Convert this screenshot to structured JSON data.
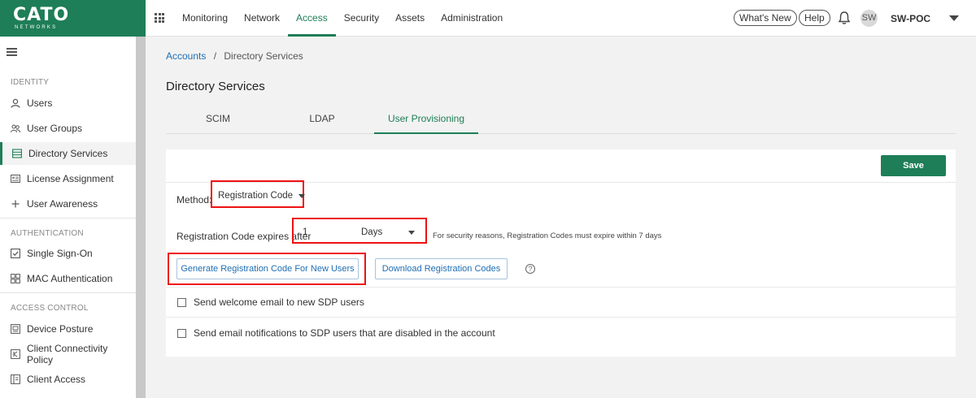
{
  "brand": {
    "name": "CATO",
    "subtitle": "NETWORKS",
    "color": "#1e7e57"
  },
  "topnav": {
    "items": [
      "Monitoring",
      "Network",
      "Access",
      "Security",
      "Assets",
      "Administration"
    ],
    "active": "Access",
    "whats_new": "What's New",
    "help": "Help",
    "avatar_initials": "SW",
    "account_name": "SW-POC"
  },
  "sidebar": {
    "sections": [
      {
        "title": "IDENTITY",
        "items": [
          {
            "label": "Users",
            "icon": "user-icon"
          },
          {
            "label": "User Groups",
            "icon": "user-group-icon"
          },
          {
            "label": "Directory Services",
            "icon": "directory-icon",
            "active": true
          },
          {
            "label": "License Assignment",
            "icon": "license-icon"
          },
          {
            "label": "User Awareness",
            "icon": "plus-icon"
          }
        ]
      },
      {
        "title": "AUTHENTICATION",
        "items": [
          {
            "label": "Single Sign-On",
            "icon": "checkbox-icon"
          },
          {
            "label": "MAC Authentication",
            "icon": "grid-icon"
          }
        ]
      },
      {
        "title": "ACCESS CONTROL",
        "items": [
          {
            "label": "Device Posture",
            "icon": "device-icon"
          },
          {
            "label": "Client Connectivity Policy",
            "icon": "policy-icon"
          },
          {
            "label": "Client Access",
            "icon": "client-access-icon"
          }
        ]
      }
    ]
  },
  "breadcrumb": {
    "parent": "Accounts",
    "separator": "/",
    "current": "Directory Services"
  },
  "page_title": "Directory Services",
  "tabs": [
    {
      "label": "SCIM"
    },
    {
      "label": "LDAP"
    },
    {
      "label": "User Provisioning",
      "active": true
    }
  ],
  "form": {
    "save_label": "Save",
    "method_label": "Method:",
    "method_value": "Registration Code",
    "expires_label": "Registration Code expires after",
    "expires_value": "1",
    "expires_unit": "Days",
    "expires_hint": "For security reasons, Registration Codes must expire within 7 days",
    "generate_button": "Generate Registration Code For New Users",
    "download_button": "Download Registration Codes",
    "help_glyph": "?",
    "checkboxes": [
      {
        "label": "Send welcome email to new SDP users",
        "checked": false
      },
      {
        "label": "Send email notifications to SDP users that are disabled in the account",
        "checked": false
      }
    ]
  }
}
